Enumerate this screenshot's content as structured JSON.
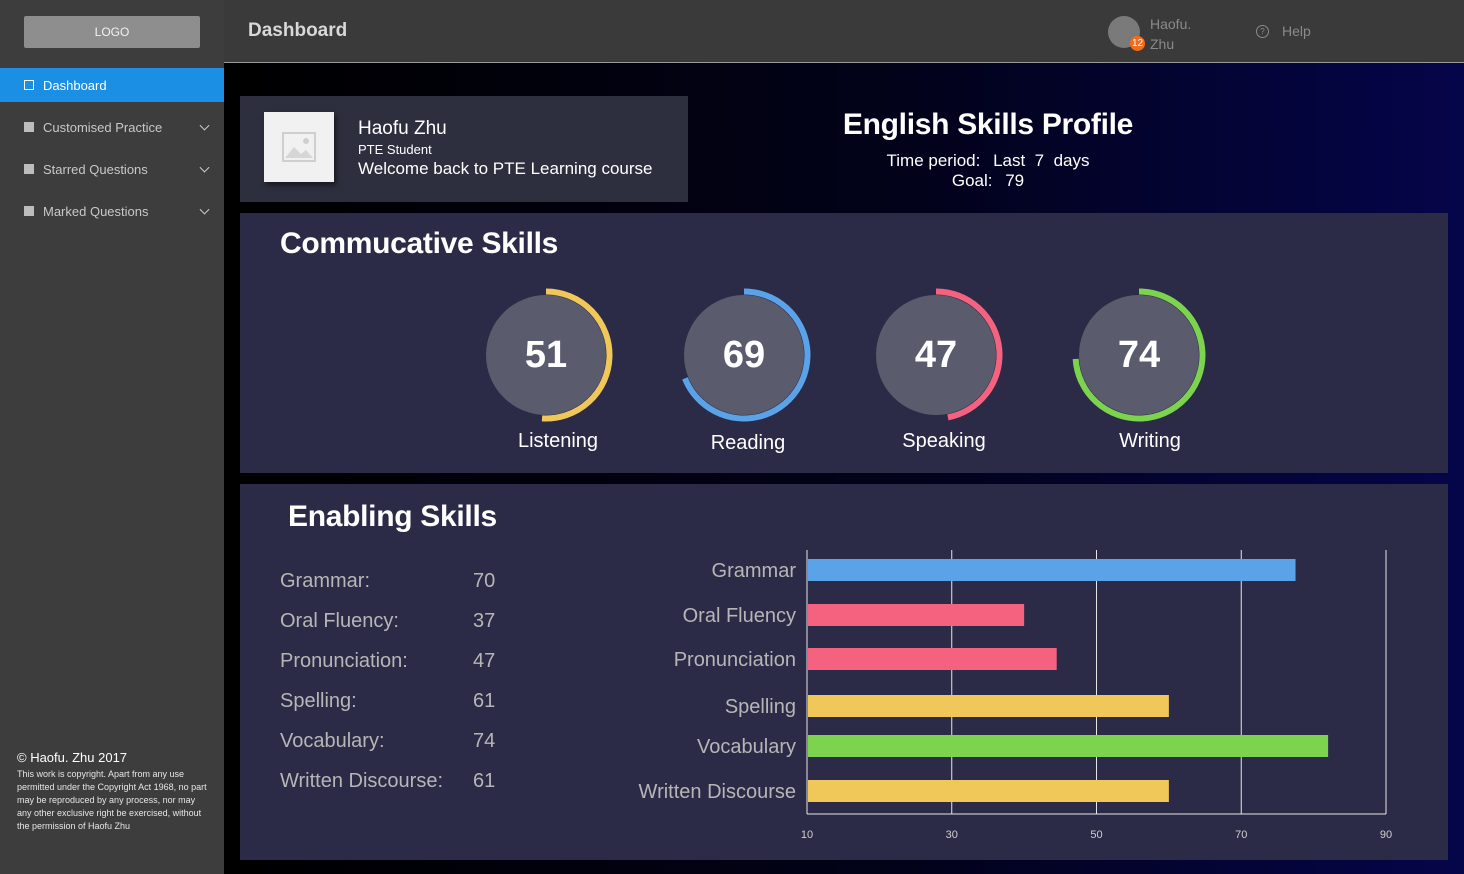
{
  "sidebar": {
    "logo": "LOGO",
    "items": [
      {
        "label": "Dashboard",
        "active": true,
        "expandable": false
      },
      {
        "label": "Customised Practice",
        "active": false,
        "expandable": true
      },
      {
        "label": "Starred Questions",
        "active": false,
        "expandable": true
      },
      {
        "label": "Marked Questions",
        "active": false,
        "expandable": true
      }
    ],
    "copyright_title": "© Haofu. Zhu 2017",
    "copyright_text": "This work is copyright. Apart from any use permitted under the Copyright Act 1968, no part may be reproduced by any process, nor may any other exclusive right be exercised, without the permission of Haofu Zhu"
  },
  "header": {
    "title": "Dashboard",
    "help_label": "Help",
    "help_icon": "?",
    "user_name": "Haofu. Zhu",
    "notification_count": "12"
  },
  "profile": {
    "name": "Haofu Zhu",
    "role": "PTE Student",
    "welcome": "Welcome back to PTE Learning course"
  },
  "skills_profile": {
    "title": "English Skills Profile",
    "time_period_label": "Time period:",
    "time_period_value": "Last  7  days",
    "goal_label": "Goal:",
    "goal_value": "79"
  },
  "communicative": {
    "title": "Commucative Skills",
    "skills": [
      {
        "label": "Listening",
        "value": 51,
        "color": "#f0c85a"
      },
      {
        "label": "Reading",
        "value": 69,
        "color": "#5ba3e8"
      },
      {
        "label": "Speaking",
        "value": 47,
        "color": "#f5627f"
      },
      {
        "label": "Writing",
        "value": 74,
        "color": "#7cd44e"
      }
    ]
  },
  "enabling": {
    "title": "Enabling Skills",
    "items": [
      {
        "label": "Grammar:",
        "value": "70"
      },
      {
        "label": "Oral Fluency:",
        "value": "37"
      },
      {
        "label": "Pronunciation:",
        "value": "47"
      },
      {
        "label": "Spelling:",
        "value": "61"
      },
      {
        "label": "Vocabulary:",
        "value": "74"
      },
      {
        "label": "Written Discourse:",
        "value": "61"
      }
    ]
  },
  "chart_data": {
    "type": "bar",
    "orientation": "horizontal",
    "categories": [
      "Grammar",
      "Oral Fluency",
      "Pronunciation",
      "Spelling",
      "Vocabulary",
      "Written Discourse"
    ],
    "values": [
      77.5,
      40,
      44.5,
      60,
      82,
      60
    ],
    "colors": [
      "#5ba3e8",
      "#f5627f",
      "#f5627f",
      "#f0c85a",
      "#7cd44e",
      "#f0c85a"
    ],
    "xticks": [
      10,
      30,
      50,
      70,
      90
    ],
    "xlim": [
      10,
      90
    ],
    "grid": true
  }
}
